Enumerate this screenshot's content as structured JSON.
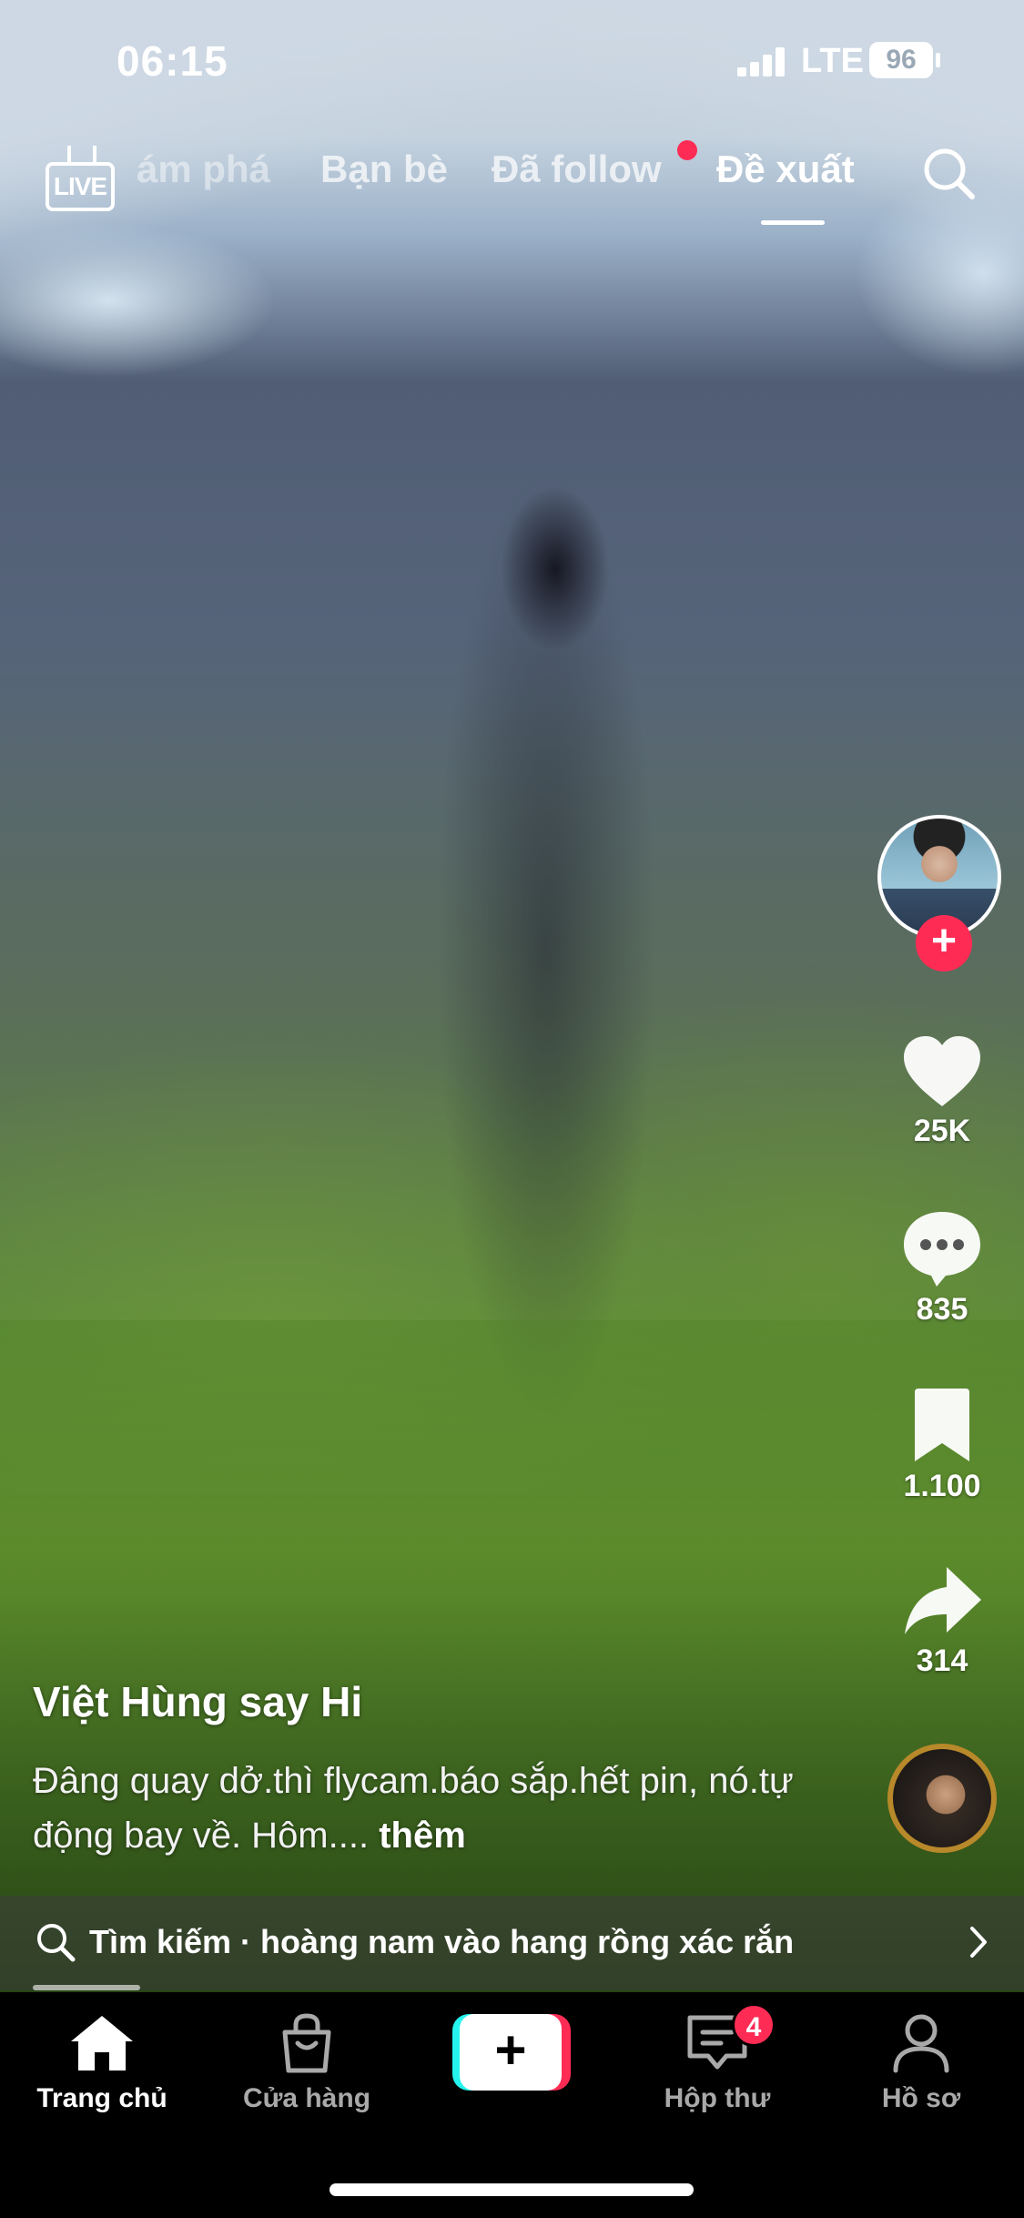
{
  "status": {
    "time": "06:15",
    "network": "LTE",
    "battery": "96"
  },
  "nav": {
    "live_label": "LIVE",
    "tabs": [
      {
        "label": "ám phá"
      },
      {
        "label": "Bạn bè"
      },
      {
        "label": "Đã follow"
      },
      {
        "label": "Đề xuất"
      }
    ]
  },
  "actions": {
    "like_count": "25K",
    "comment_count": "835",
    "save_count": "1.100",
    "share_count": "314"
  },
  "caption": {
    "author": "Việt Hùng say Hi",
    "description": "Đâng quay dở.thì flycam.báo sắp.hết pin, nó.tự động bay về. Hôm.... ",
    "more": "thêm"
  },
  "search_suggestion": {
    "text": "Tìm kiếm · hoàng nam vào hang rồng xác rắn"
  },
  "tabbar": {
    "home": "Trang chủ",
    "shop": "Cửa hàng",
    "create": "+",
    "inbox": "Hộp thư",
    "inbox_badge": "4",
    "profile": "Hồ sơ"
  },
  "colors": {
    "accent_red": "#fe2c55",
    "accent_cyan": "#25f4ee"
  }
}
